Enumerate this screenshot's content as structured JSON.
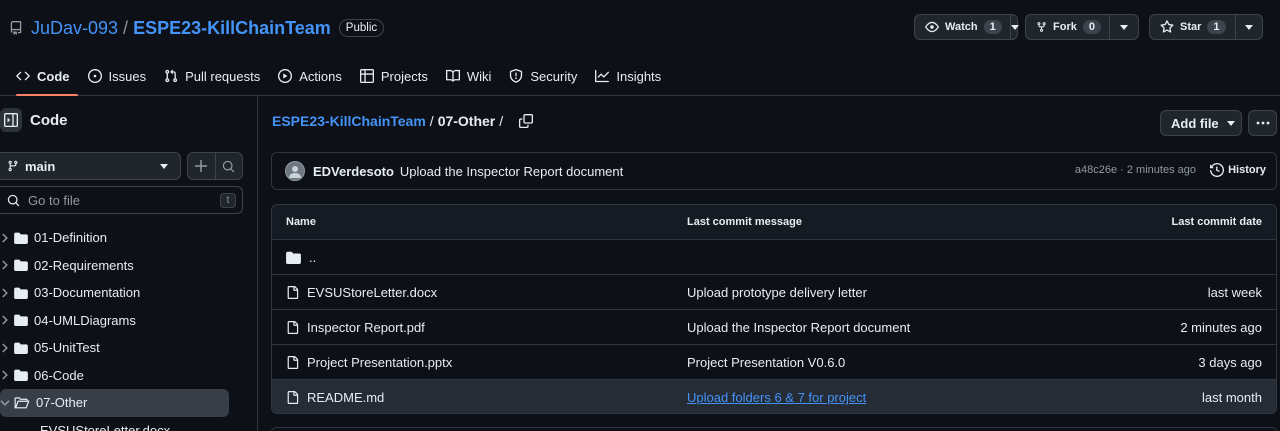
{
  "repo": {
    "owner": "JuDav-093",
    "separator": "/",
    "name": "ESPE23-KillChainTeam",
    "visibility": "Public"
  },
  "header_actions": {
    "watch": {
      "label": "Watch",
      "count": "1"
    },
    "fork": {
      "label": "Fork",
      "count": "0"
    },
    "star": {
      "label": "Star",
      "count": "1"
    }
  },
  "tabs": [
    {
      "label": "Code",
      "icon": "code-icon",
      "active": true
    },
    {
      "label": "Issues",
      "icon": "issue-icon"
    },
    {
      "label": "Pull requests",
      "icon": "pull-request-icon"
    },
    {
      "label": "Actions",
      "icon": "play-icon"
    },
    {
      "label": "Projects",
      "icon": "table-icon"
    },
    {
      "label": "Wiki",
      "icon": "book-icon"
    },
    {
      "label": "Security",
      "icon": "shield-icon"
    },
    {
      "label": "Insights",
      "icon": "graph-icon"
    }
  ],
  "sidebar": {
    "title": "Code",
    "branch": "main",
    "search_placeholder": "Go to file",
    "shortcut": "t",
    "tree": [
      {
        "label": "01-Definition"
      },
      {
        "label": "02-Requirements"
      },
      {
        "label": "03-Documentation"
      },
      {
        "label": "04-UMLDiagrams"
      },
      {
        "label": "05-UnitTest"
      },
      {
        "label": "06-Code"
      },
      {
        "label": "07-Other",
        "selected": true,
        "open": true
      },
      {
        "label": "EVSUStoreLetter.docx",
        "child": true
      }
    ]
  },
  "main": {
    "breadcrumb": {
      "repo": "ESPE23-KillChainTeam",
      "sep": "/",
      "folder": "07-Other",
      "trail": "/"
    },
    "add_file_label": "Add file",
    "commit": {
      "author": "EDVerdesoto",
      "message": "Upload the Inspector Report document",
      "meta": "a48c26e · 2 minutes ago",
      "history_label": "History"
    },
    "table": {
      "headers": {
        "name": "Name",
        "message": "Last commit message",
        "date": "Last commit date"
      },
      "parent": "..",
      "rows": [
        {
          "name": "EVSUStoreLetter.docx",
          "message": "Upload prototype delivery letter",
          "date": "last week"
        },
        {
          "name": "Inspector Report.pdf",
          "message": "Upload the Inspector Report document",
          "date": "2 minutes ago"
        },
        {
          "name": "Project Presentation.pptx",
          "message": "Project Presentation V0.6.0",
          "date": "3 days ago"
        },
        {
          "name": "README.md",
          "message": "Upload folders 6 & 7 for project",
          "date": "last month",
          "hover": true
        }
      ]
    }
  },
  "colors": {
    "accent_link": "#4493f8",
    "tab_underline": "#f78166",
    "background": "#0d1117"
  }
}
